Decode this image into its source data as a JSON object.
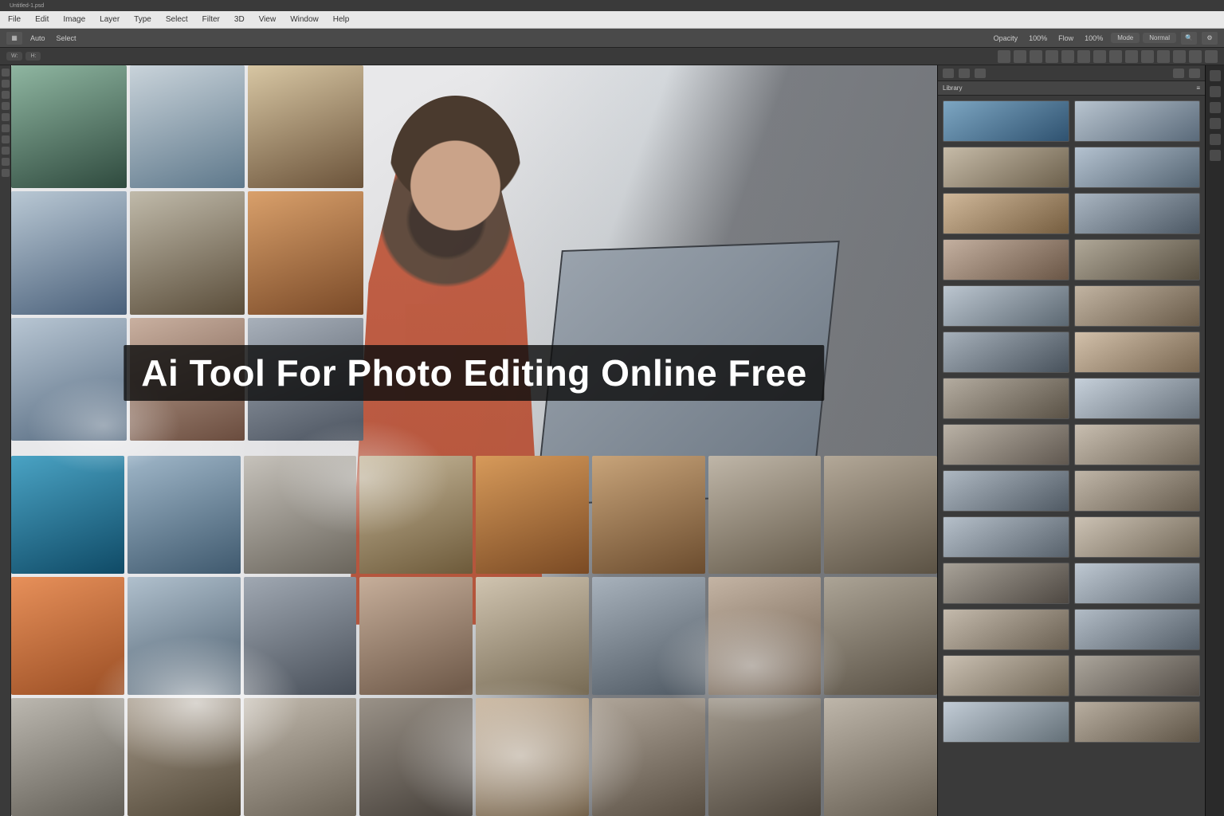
{
  "tabs": [
    "Untitled-1.psd"
  ],
  "menu": [
    "File",
    "Edit",
    "Image",
    "Layer",
    "Type",
    "Select",
    "Filter",
    "3D",
    "View",
    "Window",
    "Help"
  ],
  "toolbar": {
    "left_labels": [
      "Auto",
      "Select"
    ],
    "right_labels": [
      "Opacity",
      "100%",
      "Flow",
      "100%"
    ],
    "pills": [
      "Mode",
      "Normal"
    ]
  },
  "toolbar2": {
    "left": [
      "W:",
      "H:"
    ],
    "rightIcons": 14
  },
  "canvasTitle": "Ai Tool For Photo Editing Online Free",
  "thumbGradientsLeft": [
    "linear-gradient(160deg,#8fb6a1,#2f4a3e)",
    "linear-gradient(160deg,#c9d3da,#5e788b)",
    "linear-gradient(160deg,#d7c6a3,#6b533a)",
    "linear-gradient(160deg,#b9c8d4,#4a607a)",
    "linear-gradient(160deg,#c0baaa,#5a4d3a)",
    "linear-gradient(160deg,#d9a06b,#7a4a28)",
    "linear-gradient(160deg,#b8c6d3,#556a80)",
    "linear-gradient(160deg,#c9b0a0,#6a4c3e)",
    "linear-gradient(160deg,#a8b0ba,#4a525e)"
  ],
  "thumbGradientsBottom": [
    "linear-gradient(160deg,#4aa3c4,#0f4a66)",
    "linear-gradient(160deg,#9fb6c8,#3f596e)",
    "linear-gradient(160deg,#c6c2bb,#6a655c)",
    "linear-gradient(160deg,#c7b89a,#6d5a3a)",
    "linear-gradient(160deg,#d79a5a,#7a4a24)",
    "linear-gradient(160deg,#c8a47a,#6b4c2e)",
    "linear-gradient(160deg,#bfb6a8,#665c4c)",
    "linear-gradient(160deg,#b3a898,#5b5244)",
    "linear-gradient(160deg,#e7905a,#9a4e24)",
    "linear-gradient(160deg,#b0c0cd,#4a5c6c)",
    "linear-gradient(160deg,#a0a8b2,#484f59)",
    "linear-gradient(160deg,#c6ae9a,#6b5646)",
    "linear-gradient(160deg,#d0c4b0,#766a54)",
    "linear-gradient(160deg,#a8b2bc,#4e5862)",
    "linear-gradient(160deg,#c4b4a4,#6a5a4a)",
    "linear-gradient(160deg,#aca496,#564e42)",
    "linear-gradient(160deg,#bcb8b0,#625e56)",
    "linear-gradient(160deg,#a69a8a,#524838)",
    "linear-gradient(160deg,#c2baae,#6a6256)",
    "linear-gradient(160deg,#9a9288,#46403a)",
    "linear-gradient(160deg,#c8b49c,#6e5c44)",
    "linear-gradient(160deg,#b0a69a,#584e42)",
    "linear-gradient(160deg,#a49c90,#4e463c)",
    "linear-gradient(160deg,#beb6aa,#665e52)"
  ],
  "panelThumbs": [
    "linear-gradient(150deg,#7da6c2,#2f5270)",
    "linear-gradient(150deg,#b8c4cf,#5a6a7a)",
    "linear-gradient(150deg,#c6bba8,#6c604c)",
    "linear-gradient(150deg,#b4c2d0,#546472)",
    "linear-gradient(150deg,#d0b89a,#765e40)",
    "linear-gradient(150deg,#aab6c2,#4c5864)",
    "linear-gradient(150deg,#c4b0a0,#6a5646)",
    "linear-gradient(150deg,#b0a898,#564e40)",
    "linear-gradient(150deg,#bcc6d0,#5c6872)",
    "linear-gradient(150deg,#c2b4a2,#685a48)",
    "linear-gradient(150deg,#a6b0ba,#48525c)",
    "linear-gradient(150deg,#d2c0aa,#786650)",
    "linear-gradient(150deg,#b4aca0,#5a5246)",
    "linear-gradient(150deg,#c6d0da,#68727c)",
    "linear-gradient(150deg,#bab2a6,#605850)",
    "linear-gradient(150deg,#c8beb0,#6e6456)",
    "linear-gradient(150deg,#aeb8c2,#505a64)",
    "linear-gradient(150deg,#c0b6a8,#665c4e)",
    "linear-gradient(150deg,#b6c0ca,#58626c)",
    "linear-gradient(150deg,#ccc2b4,#726858)",
    "linear-gradient(150deg,#a8a298,#4e4842)",
    "linear-gradient(150deg,#bec8d2,#606a74)",
    "linear-gradient(150deg,#c4baac,#6a6052)",
    "linear-gradient(150deg,#b2bcc6,#545e68)",
    "linear-gradient(150deg,#cac0b2,#706656)",
    "linear-gradient(150deg,#aca69c,#524c46)",
    "linear-gradient(150deg,#c2ccd6,#647078)",
    "linear-gradient(150deg,#b8aea0,#5e5446)"
  ],
  "panel": {
    "title": "Library"
  },
  "colors": {
    "title_overlay_bg": "rgba(15,15,15,.82)",
    "title_text": "#ffffff",
    "accent_orange": "#c15a3e"
  }
}
